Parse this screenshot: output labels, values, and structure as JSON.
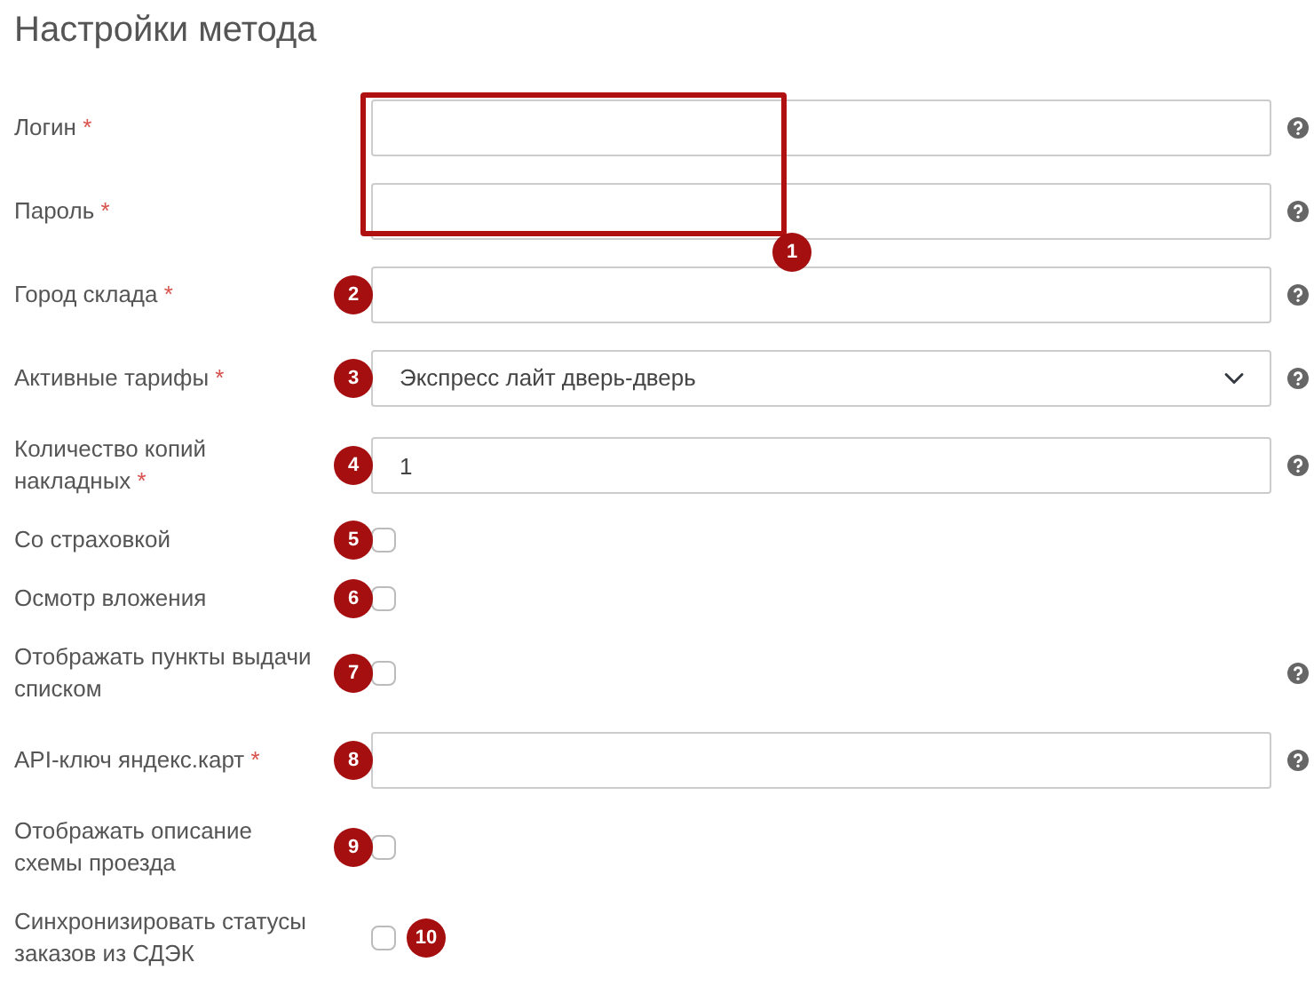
{
  "title": "Настройки метода",
  "fields": [
    {
      "kind": "text",
      "label": "Логин",
      "required_mark": "*",
      "help": true,
      "highlighted": true
    },
    {
      "kind": "text",
      "label": "Пароль",
      "required_mark": "*",
      "help": true,
      "highlighted": true
    },
    {
      "kind": "text",
      "label": "Город склада",
      "required_mark": "*",
      "help": true,
      "callout": "2"
    },
    {
      "kind": "select",
      "label": "Активные тарифы",
      "required_mark": "*",
      "value": "Экспресс лайт дверь-дверь",
      "help": true,
      "callout": "3"
    },
    {
      "kind": "text",
      "label": "Количество копий накладных",
      "required_mark": "*",
      "value": "1",
      "help": true,
      "callout": "4"
    },
    {
      "kind": "checkbox",
      "label": "Со страховкой",
      "checked": false,
      "callout": "5"
    },
    {
      "kind": "checkbox",
      "label": "Осмотр вложения",
      "checked": false,
      "callout": "6"
    },
    {
      "kind": "checkbox",
      "label": "Отображать пункты выдачи списком",
      "checked": false,
      "help": true,
      "callout": "7"
    },
    {
      "kind": "text",
      "label": "API-ключ яндекс.карт",
      "required_mark": "*",
      "help": true,
      "callout": "8"
    },
    {
      "kind": "checkbox",
      "label": "Отображать описание схемы проезда",
      "checked": false,
      "callout": "9"
    },
    {
      "kind": "checkbox",
      "label": "Синхронизировать статусы заказов из СДЭК",
      "checked": false,
      "callout": "10",
      "callout_right": true
    }
  ],
  "highlight_callout": "1"
}
